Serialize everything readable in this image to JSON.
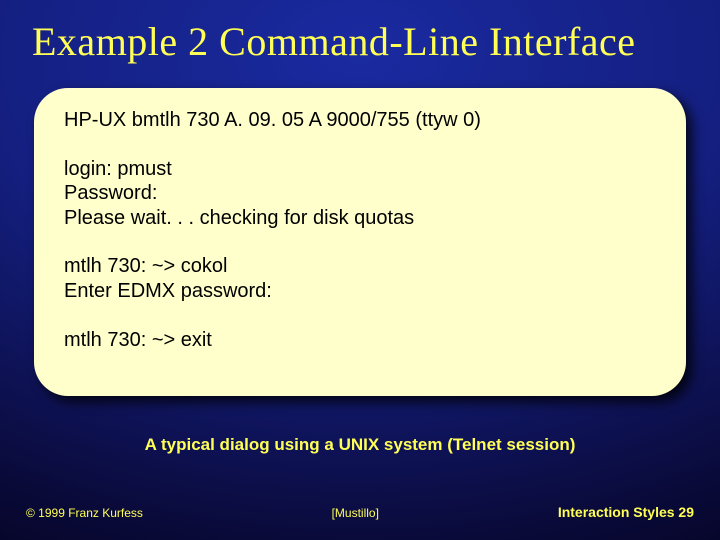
{
  "title": "Example 2 Command-Line Interface",
  "terminal": {
    "l1": "HP-UX bmtlh 730 A. 09. 05 A 9000/755 (ttyw 0)",
    "l2": "",
    "l3": "login: pmust",
    "l4": "Password:",
    "l5": "Please wait. . . checking for disk quotas",
    "l6": "",
    "l7": "mtlh 730: ~> cokol",
    "l8": "Enter EDMX password:",
    "l9": "",
    "l10": "mtlh 730: ~> exit"
  },
  "caption": "A typical dialog using a UNIX system (Telnet session)",
  "footer": {
    "copyright": "© 1999 Franz Kurfess",
    "reference": "[Mustillo]",
    "page_label": "Interaction Styles",
    "page_number": "29"
  }
}
